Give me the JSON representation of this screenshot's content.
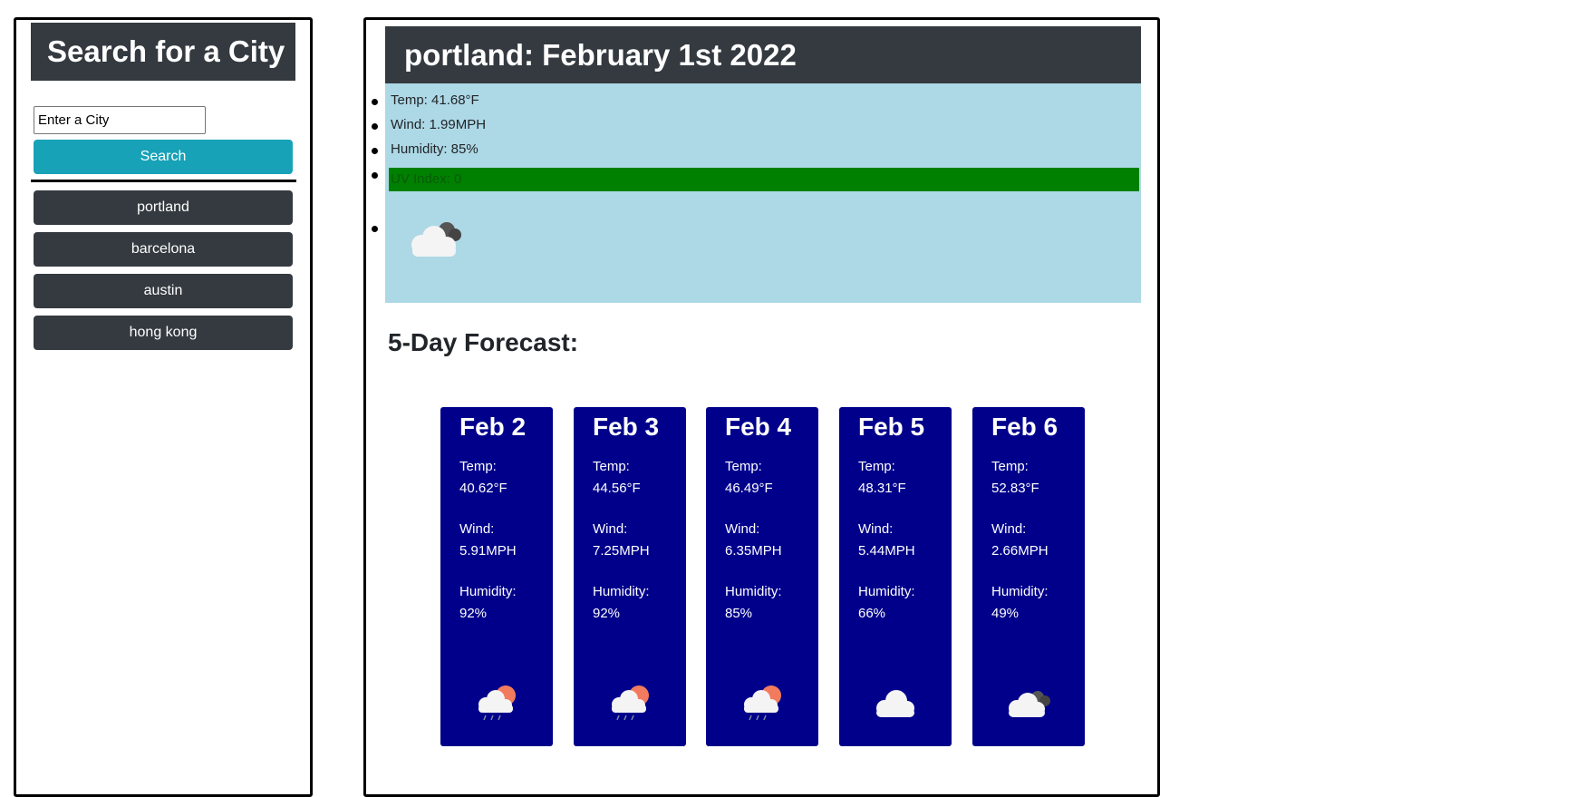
{
  "sidebar": {
    "title": "Search for a City",
    "search_placeholder": "Enter a City",
    "search_label": "Search",
    "history": [
      {
        "label": "portland"
      },
      {
        "label": "barcelona"
      },
      {
        "label": "austin"
      },
      {
        "label": "hong kong"
      }
    ]
  },
  "current": {
    "title": "portland: February 1st 2022",
    "temp": "Temp: 41.68°F",
    "wind": "Wind: 1.99MPH",
    "humidity": "Humidity: 85%",
    "uv": "UV Index: 0",
    "uv_color": "#008000",
    "icon": "partly-cloudy-night-icon"
  },
  "forecast": {
    "title": "5-Day Forecast:",
    "days": [
      {
        "date": "Feb 2",
        "temp_label": "Temp:",
        "temp": "40.62°F",
        "wind_label": "Wind:",
        "wind": "5.91MPH",
        "humidity_label": "Humidity:",
        "humidity": "92%",
        "icon": "rain-sun-icon"
      },
      {
        "date": "Feb 3",
        "temp_label": "Temp:",
        "temp": "44.56°F",
        "wind_label": "Wind:",
        "wind": "7.25MPH",
        "humidity_label": "Humidity:",
        "humidity": "92%",
        "icon": "rain-sun-icon"
      },
      {
        "date": "Feb 4",
        "temp_label": "Temp:",
        "temp": "46.49°F",
        "wind_label": "Wind:",
        "wind": "6.35MPH",
        "humidity_label": "Humidity:",
        "humidity": "85%",
        "icon": "rain-sun-icon"
      },
      {
        "date": "Feb 5",
        "temp_label": "Temp:",
        "temp": "48.31°F",
        "wind_label": "Wind:",
        "wind": "5.44MPH",
        "humidity_label": "Humidity:",
        "humidity": "66%",
        "icon": "cloud-icon"
      },
      {
        "date": "Feb 6",
        "temp_label": "Temp:",
        "temp": "52.83°F",
        "wind_label": "Wind:",
        "wind": "2.66MPH",
        "humidity_label": "Humidity:",
        "humidity": "49%",
        "icon": "dark-clouds-icon"
      }
    ]
  },
  "colors": {
    "header_bg": "#343a40",
    "search_button": "#17a2b8",
    "current_bg": "#add8e6",
    "forecast_card_bg": "#00008b"
  }
}
